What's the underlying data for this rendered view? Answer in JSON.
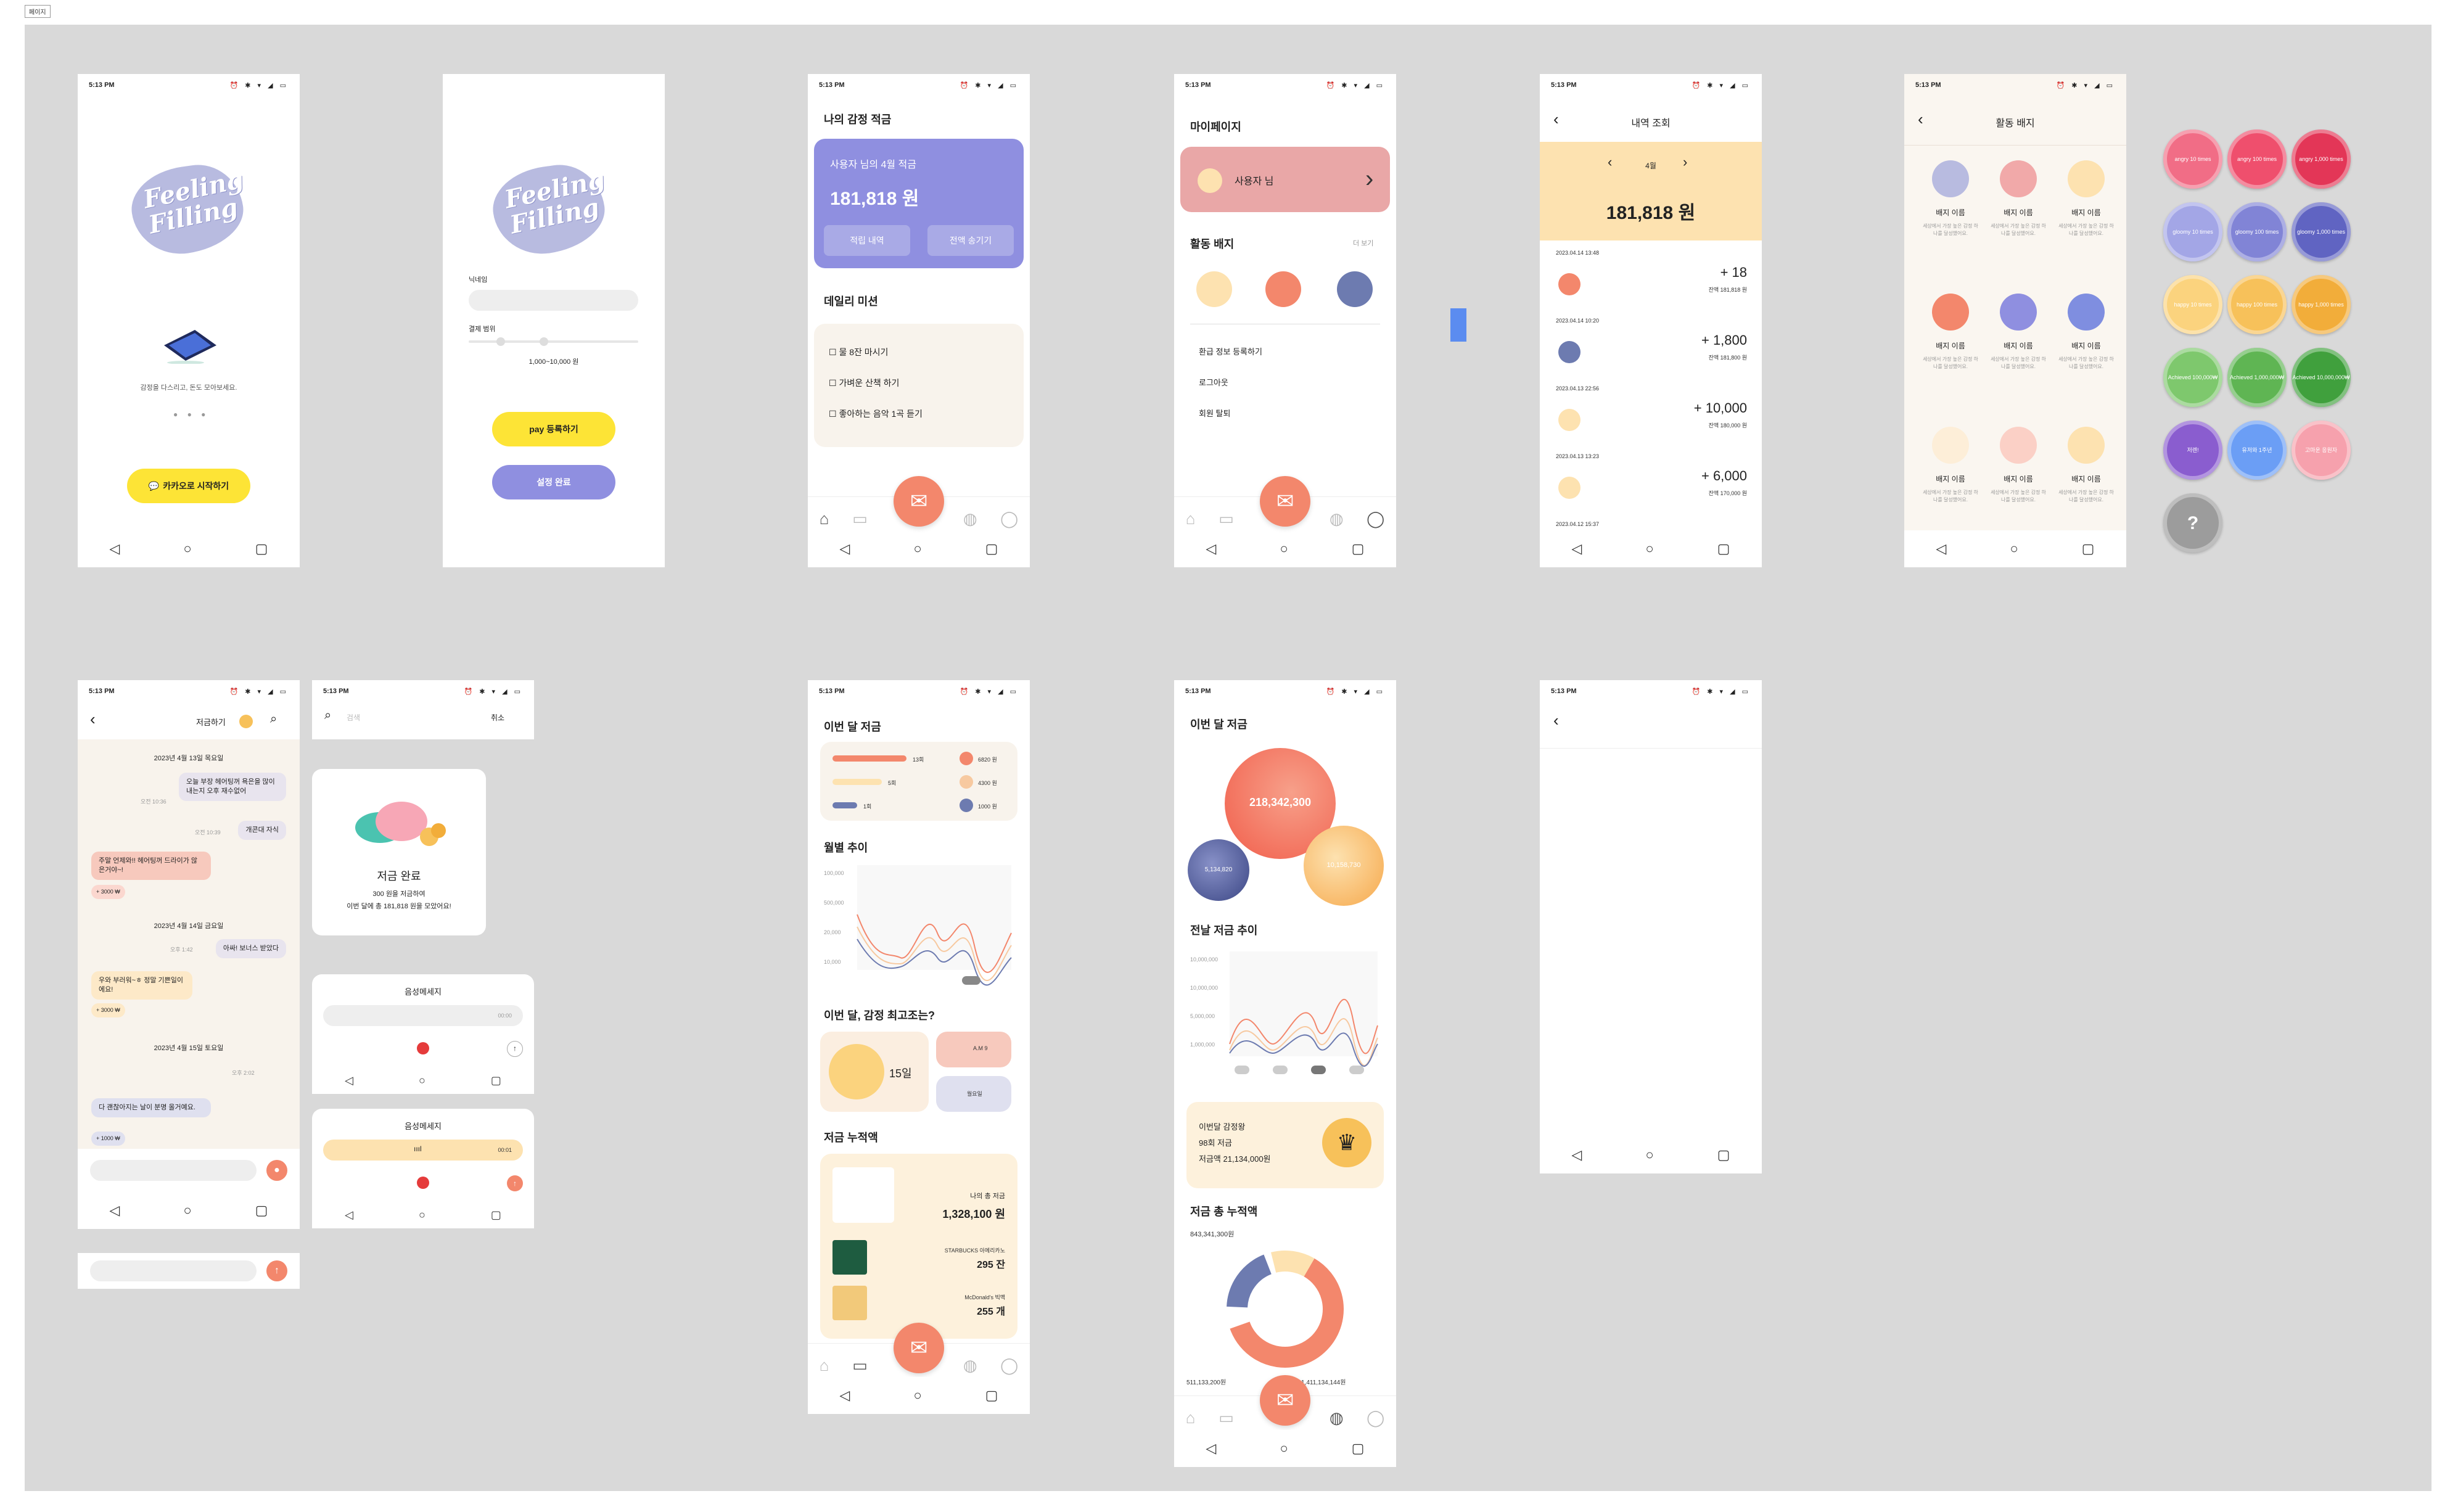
{
  "page_label": "페이지",
  "status_time": "5:13 PM",
  "status_icons": "⏰ ✱ ▾ ◢ ▭",
  "nav": {
    "back": "◁",
    "home": "○",
    "recent": "▢"
  },
  "colors": {
    "canvas": "#d9d9d9",
    "purple": "#8f8fe0",
    "coral": "#f3876c",
    "yellow": "#fde436",
    "cream": "#fde2b0"
  },
  "login": {
    "tagline": "감정을 다스리고, 돈도 모아보세요.",
    "kakao_btn": "카카오로 시작하기",
    "logo": "Feeling Filling"
  },
  "setup": {
    "nickname_label": "닉네임",
    "range_label": "결제 범위",
    "range_value": "1,000~10,000 원",
    "pay_btn": "pay 등록하기",
    "done_btn": "설정 완료",
    "logo": "Feeling Filling"
  },
  "home": {
    "title": "나의 감정 적금",
    "card_title": "사용자 님의 4월 적금",
    "amount": "181,818 원",
    "btn_history": "적립 내역",
    "btn_send": "전액 송기기",
    "mission_title": "데일리 미션",
    "missions": [
      "물 8잔 마시기",
      "가벼운 산책 하기",
      "좋아하는 음악 1곡 듣기"
    ]
  },
  "mypage": {
    "title": "마이페이지",
    "user": "사용자 님",
    "badge_title": "활동 배지",
    "more": "더 보기",
    "menu": [
      "환급 정보 등록하기",
      "로그아웃",
      "회원 탈퇴"
    ]
  },
  "history": {
    "title": "내역 조회",
    "month": "4월",
    "total": "181,818 원",
    "rows": [
      {
        "date": "2023.04.14 13:48",
        "amount": "+ 18",
        "balance": "잔액 181,818 원"
      },
      {
        "date": "2023.04.14 10:20",
        "amount": "+ 1,800",
        "balance": "잔액 181,800 원"
      },
      {
        "date": "2023.04.13 22:56",
        "amount": "+ 10,000",
        "balance": "잔액 180,000 원"
      },
      {
        "date": "2023.04.13 13:23",
        "amount": "+ 6,000",
        "balance": "잔액 170,000 원"
      },
      {
        "date": "2023.04.12 15:37",
        "amount": "",
        "balance": ""
      }
    ]
  },
  "badges": {
    "title": "활동 배지",
    "name": "배지 이름",
    "desc": "세상에서 가장 높은 감정 하나를 달성했어요."
  },
  "badge_set": [
    {
      "label": "angry 10 times",
      "color": "#f16d86"
    },
    {
      "label": "angry 100 times",
      "color": "#ef4f6d"
    },
    {
      "label": "angry 1,000 times",
      "color": "#e33657"
    },
    {
      "label": "gloomy 10 times",
      "color": "#a3a6e6"
    },
    {
      "label": "gloomy 100 times",
      "color": "#8184d6"
    },
    {
      "label": "gloomy 1,000 times",
      "color": "#6064c2"
    },
    {
      "label": "happy 10 times",
      "color": "#fbd37e"
    },
    {
      "label": "happy 100 times",
      "color": "#f7c15a"
    },
    {
      "label": "happy 1,000 times",
      "color": "#f2ad3a"
    },
    {
      "label": "Achieved 100,000₩",
      "color": "#7ec86d"
    },
    {
      "label": "Achieved 1,000,000₩",
      "color": "#5fb553"
    },
    {
      "label": "Achieved 10,000,000₩",
      "color": "#40a03d"
    },
    {
      "label": "저렌!",
      "color": "#8a5dcf"
    },
    {
      "label": "유저와 1주년",
      "color": "#6b9ef5"
    },
    {
      "label": "고마운 응원자",
      "color": "#f6a1ad"
    },
    {
      "label": "?",
      "color": "#9c9c9c"
    }
  ],
  "chat": {
    "header_btn": "저금하기",
    "dates": [
      "2023년 4월 13일 목요일",
      "2023년 4월 14일 금요일",
      "2023년 4월 15일 토요일"
    ],
    "msgs": [
      "오늘 부장 헤어팅꺼 욕은을 많이 내는지 오후 재수없어",
      "개콘대 자식",
      "주말 언제와!! 헤어팅꺼 드라이가 않은거야~!",
      "아싸! 보너스 받았다",
      "우와 부러워~ㅎ 정말 기쁜일이에요!",
      "다 괜찮아지는 날이 분명 올거예요."
    ],
    "times": [
      "오전 10:36",
      "오전 10:39",
      "오후 1:42",
      "오후 2:02"
    ],
    "amounts": [
      "+ 3000 ₩",
      "+ 3000 ₩",
      "+ 1000 ₩"
    ]
  },
  "search": {
    "placeholder": "검색",
    "cancel": "취소"
  },
  "saved": {
    "title": "저금 완료",
    "line1": "300 원을 저금하여",
    "line2": "이번 달에 총 181,818 원을 모았어요!"
  },
  "voice": {
    "title": "음성메세지",
    "time1": "00:00",
    "time2": "00:01"
  },
  "stats": {
    "month_title": "이번 달 저금",
    "bars": [
      {
        "count": "13회",
        "amount": "6820 원"
      },
      {
        "count": "5회",
        "amount": "4300 원"
      },
      {
        "count": "1회",
        "amount": "1000 원"
      }
    ],
    "monthly_title": "월별 추이",
    "yticks": [
      "100,000",
      "500,000",
      "20,000",
      "10,000"
    ],
    "best_title": "이번 달, 감정 최고조는?",
    "best_day": "15일",
    "best_extra": "A.M 9",
    "best_extra2": "월요일",
    "total_title": "저금 누적액",
    "total_label": "나의 총 저금",
    "total_amount": "1,328,100 원",
    "starbucks": "STARBUCKS 아메리카노",
    "starbucks_v": "295 잔",
    "mcd": "McDonald's 빅맥",
    "mcd_v": "255 개"
  },
  "stats2": {
    "month_title": "이번 달 저금",
    "big": "218,342,300",
    "left": "5,134,820",
    "right": "10,158,730",
    "trend_title": "전날 저금 추이",
    "yticks": [
      "10,000,000",
      "10,000,000",
      "5,000,000",
      "1,000,000"
    ],
    "king_title": "이번달 감정왕",
    "king_l2": "98회 저금",
    "king_l3": "저금액 21,134,000원",
    "cum_title": "저금 총 누적액",
    "d1": "843,341,300원",
    "d2": "511,133,200원",
    "d3": "1,411,134,144원"
  }
}
